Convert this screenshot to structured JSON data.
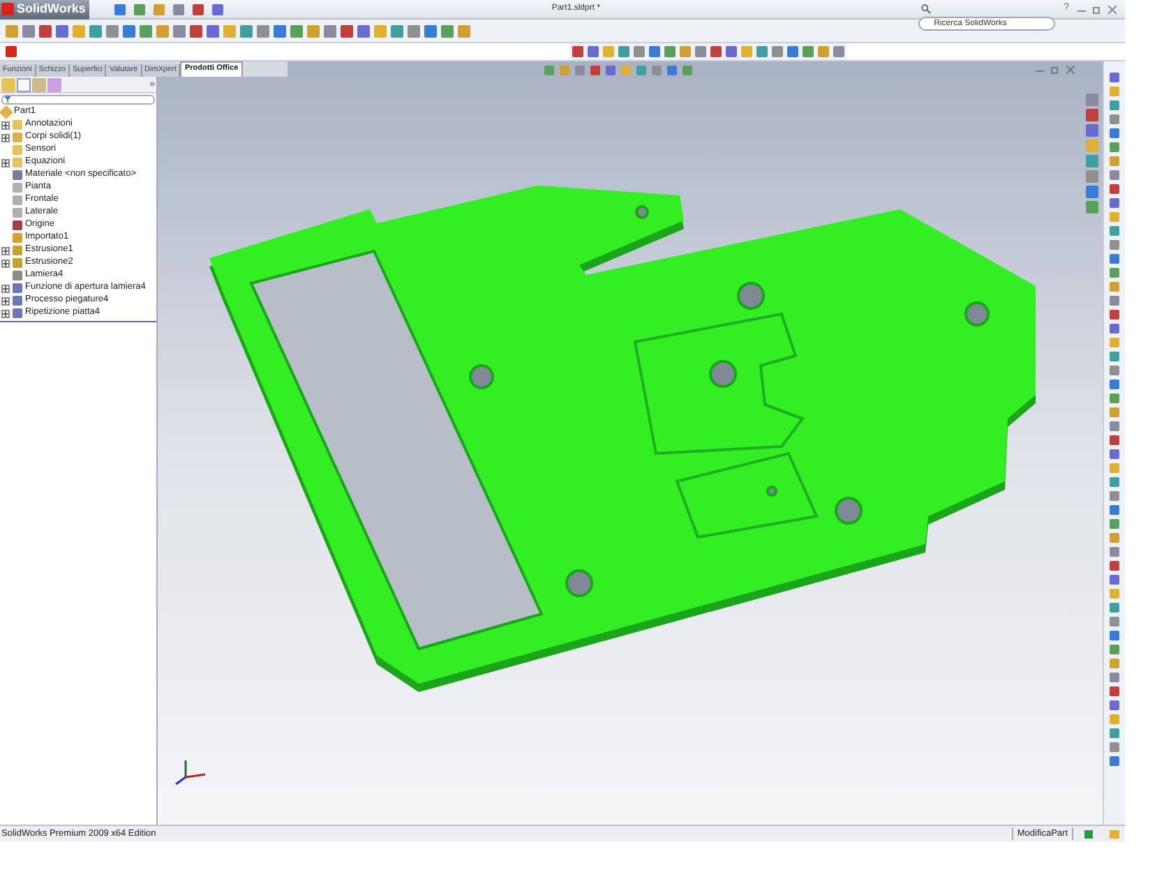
{
  "window": {
    "app": "SolidWorks",
    "title": "Part1.sldprt *",
    "search": {
      "placeholder": "Ricerca SolidWorks"
    },
    "help": "?"
  },
  "tabs": [
    {
      "label": "Funzioni",
      "selected": false
    },
    {
      "label": "Schizzo",
      "selected": false
    },
    {
      "label": "Superfici",
      "selected": false
    },
    {
      "label": "Valutare",
      "selected": false
    },
    {
      "label": "DimXpert",
      "selected": false
    },
    {
      "label": "Prodotti Office",
      "selected": true
    }
  ],
  "feature_tree": {
    "more": "»",
    "root": "Part1",
    "items": [
      {
        "label": "Annotazioni",
        "expander": true
      },
      {
        "label": "Corpi solidi(1)",
        "expander": true
      },
      {
        "label": "Sensori",
        "expander": false
      },
      {
        "label": "Equazioni",
        "expander": true
      },
      {
        "label": "Materiale <non specificato>",
        "expander": false
      },
      {
        "label": "Pianta",
        "expander": false
      },
      {
        "label": "Frontale",
        "expander": false
      },
      {
        "label": "Laterale",
        "expander": false
      },
      {
        "label": "Origine",
        "expander": false
      },
      {
        "label": "Importato1",
        "expander": false
      },
      {
        "label": "Estrusione1",
        "expander": true
      },
      {
        "label": "Estrusione2",
        "expander": true
      },
      {
        "label": "Lamiera4",
        "expander": false
      },
      {
        "label": "Funzione di apertura lamiera4",
        "expander": true
      },
      {
        "label": "Processo piegature4",
        "expander": true
      },
      {
        "label": "Ripetizione piatta4",
        "expander": true
      }
    ]
  },
  "status_bar": {
    "edition": "SolidWorks Premium 2009 x64 Edition",
    "mode": "ModificaPart"
  }
}
